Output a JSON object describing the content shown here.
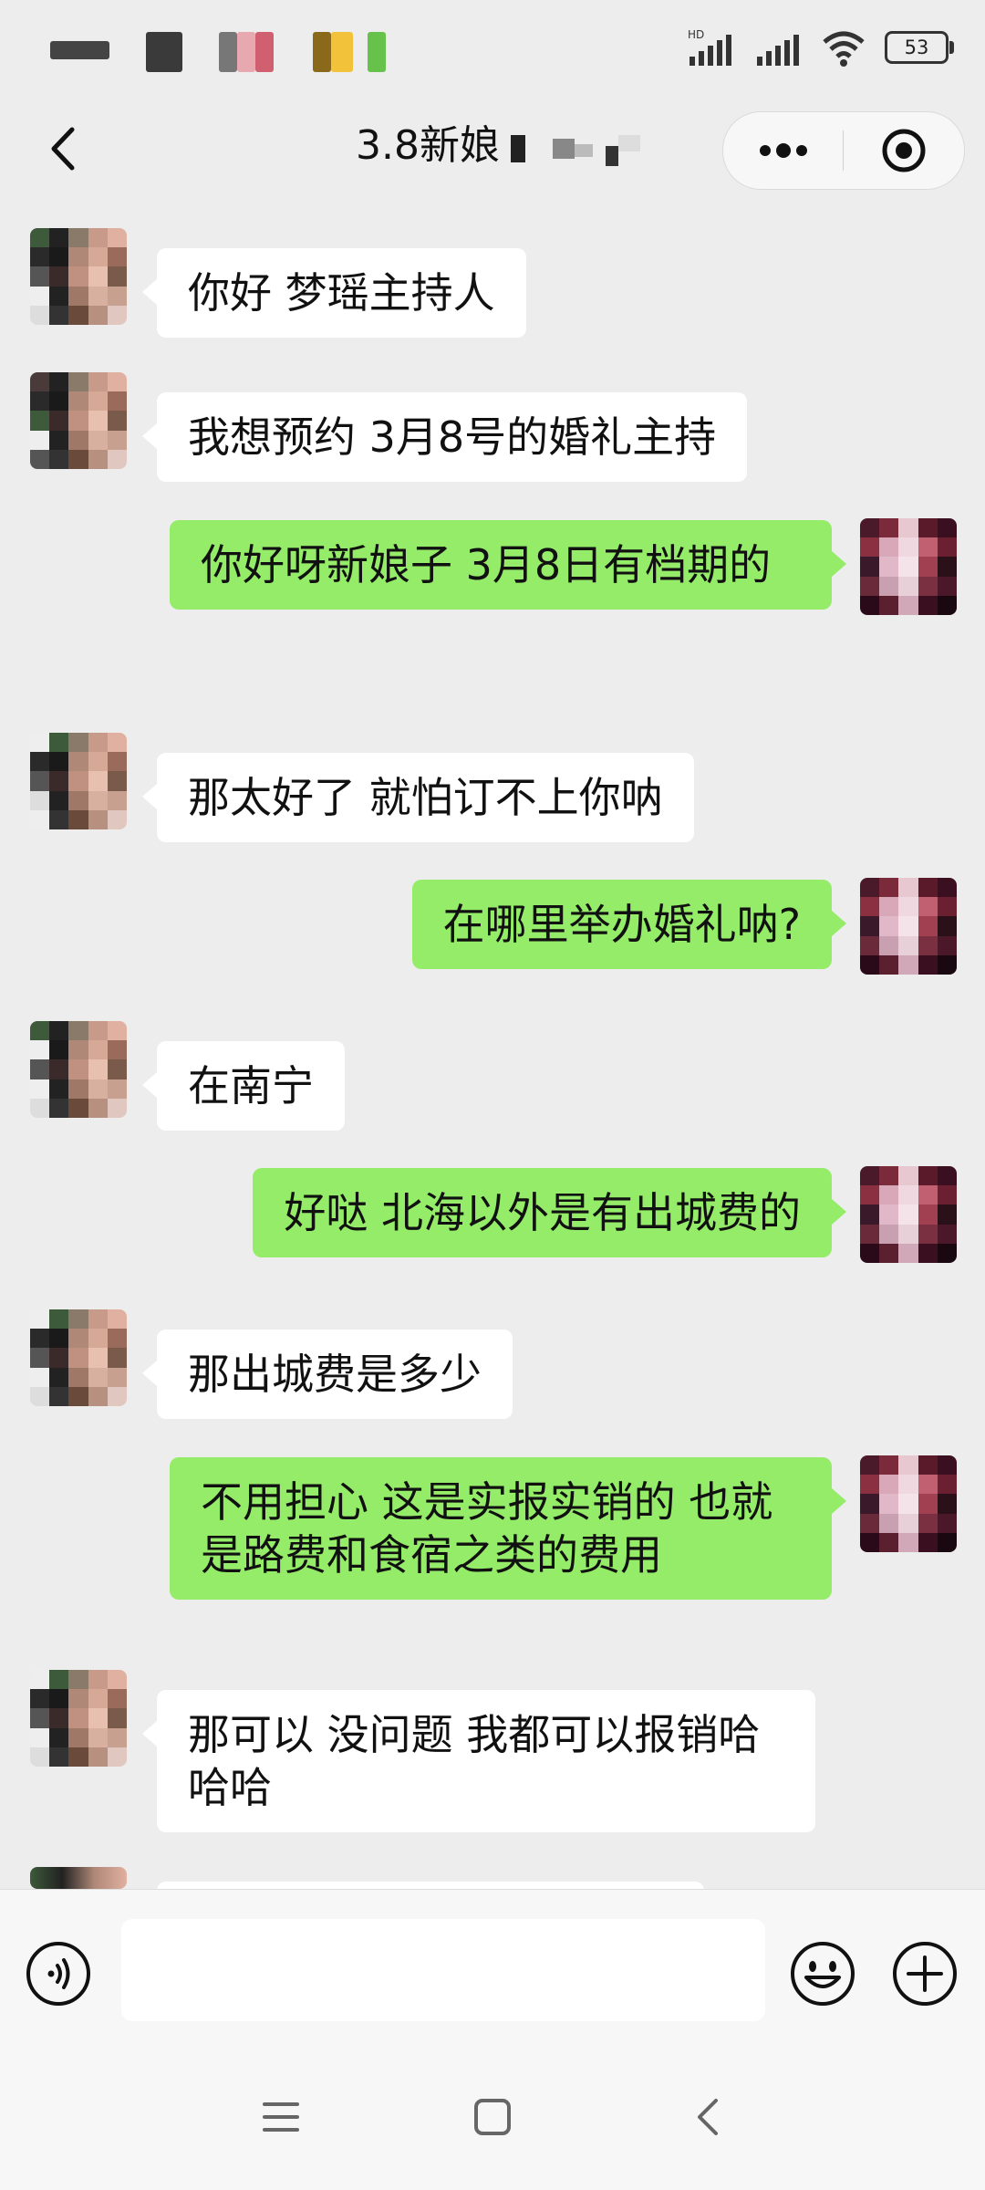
{
  "status_bar": {
    "battery": "53",
    "network_label": "HD"
  },
  "header": {
    "title": "3.8新娘"
  },
  "messages": [
    {
      "side": "in",
      "text": "你好 梦瑶主持人"
    },
    {
      "side": "in",
      "text": "我想预约 3月8号的婚礼主持"
    },
    {
      "side": "out",
      "text": "你好呀新娘子  3月8日有档期的"
    },
    {
      "side": "in",
      "text": "那太好了 就怕订不上你呐"
    },
    {
      "side": "out",
      "text": "在哪里举办婚礼呐?"
    },
    {
      "side": "in",
      "text": "在南宁"
    },
    {
      "side": "out",
      "text": "好哒 北海以外是有出城费的"
    },
    {
      "side": "in",
      "text": "那出城费是多少"
    },
    {
      "side": "out",
      "text": "不用担心 这是实报实销的 也就是路费和食宿之类的费用"
    },
    {
      "side": "in",
      "text": "那可以 没问题 我都可以报销哈哈哈"
    }
  ],
  "input": {
    "placeholder": ""
  },
  "icons": {
    "back": "chevron-left-icon",
    "more": "more-dots-icon",
    "close_miniprogram": "target-circle-icon",
    "voice": "voice-icon",
    "emoji": "emoji-icon",
    "plus": "plus-icon",
    "nav_menu": "menu-icon",
    "nav_home": "home-square-icon",
    "nav_back": "back-triangle-icon"
  },
  "colors": {
    "background": "#EDEDED",
    "outgoing_bubble": "#95EC69",
    "incoming_bubble": "#FFFFFF"
  }
}
